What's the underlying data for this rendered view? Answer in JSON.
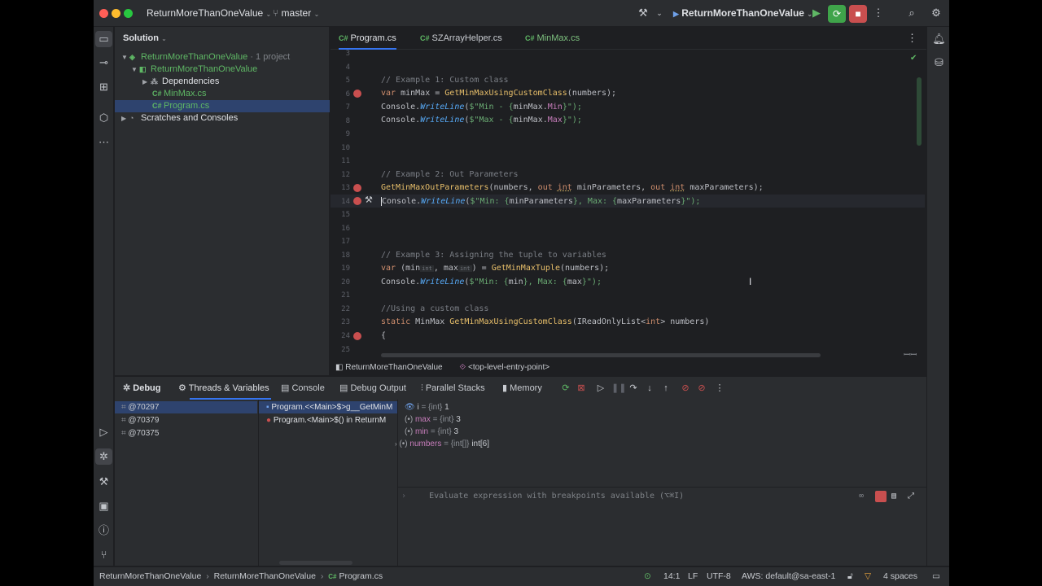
{
  "titlebar": {
    "project": "ReturnMoreThanOneValue",
    "branch": "master",
    "run_config": "ReturnMoreThanOneValue"
  },
  "solution": {
    "header": "Solution",
    "items": [
      {
        "label": "ReturnMoreThanOneValue",
        "suffix": "· 1 project"
      },
      {
        "label": "ReturnMoreThanOneValue"
      },
      {
        "label": "Dependencies"
      },
      {
        "label": "MinMax.cs",
        "badge": "C#"
      },
      {
        "label": "Program.cs",
        "badge": "C#"
      },
      {
        "label": "Scratches and Consoles"
      }
    ]
  },
  "editor": {
    "tabs": [
      {
        "label": "Program.cs",
        "badge": "C#"
      },
      {
        "label": "SZArrayHelper.cs",
        "badge": "C#"
      },
      {
        "label": "MinMax.cs",
        "badge": "C#"
      }
    ],
    "line_numbers": [
      "3",
      "4",
      "5",
      "6",
      "7",
      "8",
      "9",
      "10",
      "11",
      "12",
      "13",
      "14",
      "15",
      "16",
      "17",
      "18",
      "19",
      "20",
      "21",
      "22",
      "23",
      "24",
      "25"
    ],
    "code": {
      "l5": "// Example 1: Custom class",
      "l6_kw": "var",
      "l6_var": "minMax",
      "l6_eq": " = ",
      "l6_fn": "GetMinMaxUsingCustomClass",
      "l6_rest": "(numbers);",
      "l7_cls": "Console",
      "l7_mt": "WriteLine",
      "l7_s1": "$\"Min - {",
      "l7_expr": "minMax.",
      "l7_prop": "Min",
      "l7_s2": "}\");",
      "l8_cls": "Console",
      "l8_mt": "WriteLine",
      "l8_s1": "$\"Max - {",
      "l8_expr": "minMax.",
      "l8_prop": "Max",
      "l8_s2": "}\");",
      "l12": "// Example 2: Out Parameters",
      "l13_fn": "GetMinMaxOutParameters",
      "l13_a": "(numbers, ",
      "l13_out1": "out",
      "l13_int1": "int",
      "l13_b": " minParameters, ",
      "l13_out2": "out",
      "l13_int2": "int",
      "l13_c": " maxParameters);",
      "l14_cls": "Console",
      "l14_mt": "WriteLine",
      "l14_s1": "$\"Min: {",
      "l14_e1": "minParameters",
      "l14_s2": "}, Max: {",
      "l14_e2": "maxParameters",
      "l14_s3": "}\");",
      "l18": "// Example 3: Assigning the tuple to variables",
      "l19_kw": "var",
      "l19_a": " (min",
      "l19_hint1": "int",
      "l19_b": ", max",
      "l19_hint2": "int",
      "l19_c": ") = ",
      "l19_fn": "GetMinMaxTuple",
      "l19_d": "(numbers);",
      "l20_cls": "Console",
      "l20_mt": "WriteLine",
      "l20_s1": "$\"Min: {",
      "l20_e1": "min",
      "l20_s2": "}, Max: {",
      "l20_e2": "max",
      "l20_s3": "}\");",
      "l22": "//Using a custom class",
      "l23_kw": "static",
      "l23_a": " MinMax ",
      "l23_fn": "GetMinMaxUsingCustomClass",
      "l23_b": "(IReadOnlyList<",
      "l23_int": "int",
      "l23_c": "> numbers)",
      "l24": "{"
    },
    "breadcrumb": {
      "project": "ReturnMoreThanOneValue",
      "member": "<top-level-entry-point>"
    }
  },
  "debug": {
    "tabs": [
      "Debug",
      "Threads & Variables",
      "Console",
      "Debug Output",
      "Parallel Stacks",
      "Memory"
    ],
    "threads": [
      "@70297",
      "@70379",
      "@70375"
    ],
    "frames": [
      "Program.<<Main>$>g__GetMinM",
      "Program.<Main>$() in ReturnM"
    ],
    "variables": [
      {
        "name": "i",
        "type": "{int}",
        "value": "1"
      },
      {
        "name": "max",
        "type": "{int}",
        "value": "3"
      },
      {
        "name": "min",
        "type": "{int}",
        "value": "3"
      },
      {
        "name": "numbers",
        "type": "{int[]}",
        "value": "int[6]"
      }
    ],
    "eval_placeholder": "Evaluate expression with breakpoints available (⌥⌘I)"
  },
  "statusbar": {
    "path": [
      "ReturnMoreThanOneValue",
      "ReturnMoreThanOneValue",
      "Program.cs"
    ],
    "position": "14:1",
    "line_ending": "LF",
    "encoding": "UTF-8",
    "aws": "AWS: default@sa-east-1",
    "indent": "4 spaces"
  },
  "colors": {
    "accent": "#3574f0",
    "breakpoint": "#c94f4f",
    "run_green": "#3fa44a",
    "stop_red": "#c94f4f"
  }
}
